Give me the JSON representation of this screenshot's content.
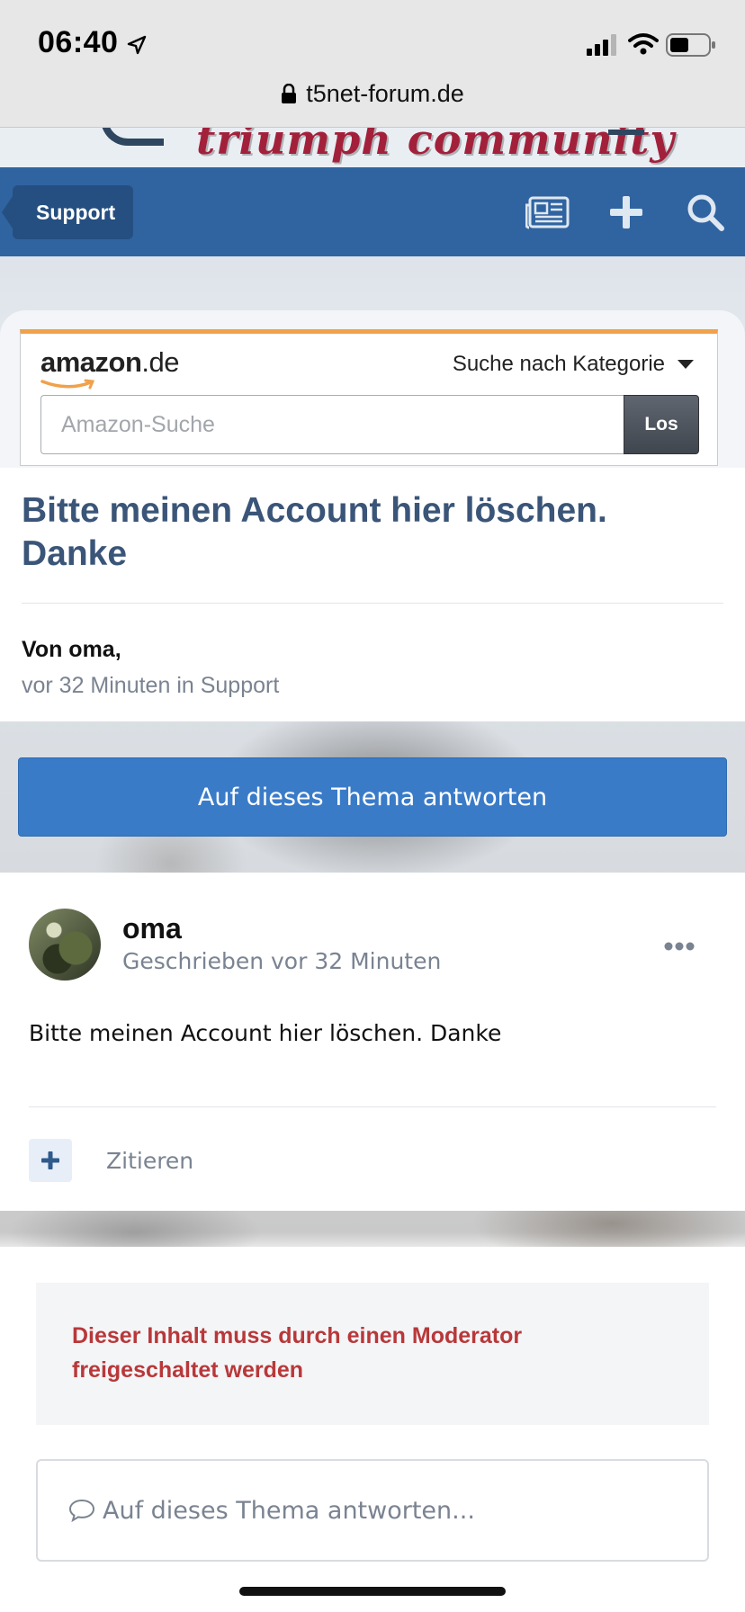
{
  "status_bar": {
    "time": "06:40",
    "url": "t5net-forum.de"
  },
  "site": {
    "logo_text": "triumph community"
  },
  "nav": {
    "back_label": "Support"
  },
  "amazon": {
    "logo_main": "amazon",
    "logo_tld": ".de",
    "category_label": "Suche nach Kategorie",
    "search_placeholder": "Amazon-Suche",
    "go_label": "Los",
    "accent_color": "#f0a14a"
  },
  "topic": {
    "title": "Bitte meinen Account hier löschen. Danke",
    "author_line": "Von oma,",
    "meta": "vor 32 Minuten in Support",
    "reply_button": "Auf dieses Thema antworten"
  },
  "post": {
    "author": "oma",
    "time": "Geschrieben vor 32 Minuten",
    "body": "Bitte meinen Account hier löschen. Danke",
    "quote_label": "Zitieren"
  },
  "moderation": {
    "notice": "Dieser Inhalt muss durch einen Moderator freigeschaltet werden"
  },
  "reply": {
    "placeholder": "Auf dieses Thema antworten..."
  },
  "colors": {
    "nav_blue": "#2f64a0",
    "button_blue": "#3a7bc8",
    "title_color": "#3a5578",
    "notice_red": "#b8383a"
  }
}
